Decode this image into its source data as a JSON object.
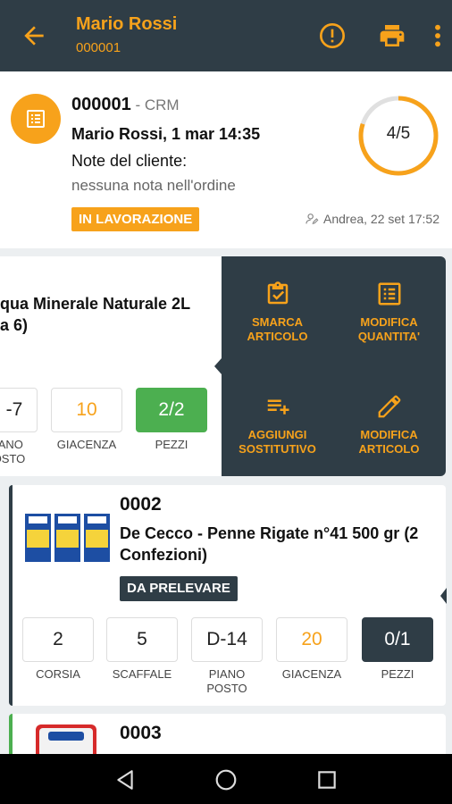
{
  "appbar": {
    "title": "Mario Rossi",
    "subtitle": "000001",
    "icons": [
      "back-arrow-icon",
      "alert-circle-icon",
      "printer-icon",
      "more-vert-icon"
    ]
  },
  "order": {
    "number": "000001",
    "source": " - CRM",
    "customer_line": "Mario Rossi, 1 mar 14:35",
    "note_label": "Note del cliente:",
    "note_value": "nessuna nota nell'ordine",
    "status": "IN LAVORAZIONE",
    "assignee": "Andrea, 22 set 17:52",
    "progress_text": "4/5",
    "progress_fraction": 0.8
  },
  "item1": {
    "name_line1": "qua Minerale Naturale 2L",
    "name_line2": "a 6)",
    "position_value": "-7",
    "position_label_1": "IANO",
    "position_label_2": "OSTO",
    "stock_value": "10",
    "stock_label": "GIACENZA",
    "pieces_value": "2/2",
    "pieces_label": "PEZZI"
  },
  "actions": [
    {
      "line1": "SMARCA",
      "line2": "ARTICOLO",
      "icon": "clipboard-check-icon"
    },
    {
      "line1": "MODIFICA",
      "line2": "QUANTITA'",
      "icon": "list-box-icon"
    },
    {
      "line1": "AGGIUNGI",
      "line2": "SOSTITUTIVO",
      "icon": "playlist-add-icon"
    },
    {
      "line1": "MODIFICA",
      "line2": "ARTICOLO",
      "icon": "pencil-icon"
    }
  ],
  "item2": {
    "code": "0002",
    "name": "De Cecco - Penne Rigate n°41 500 gr (2 Confezioni)",
    "status": "DA PRELEVARE",
    "fields": [
      {
        "value": "2",
        "label_1": "CORSIA",
        "label_2": ""
      },
      {
        "value": "5",
        "label_1": "SCAFFALE",
        "label_2": ""
      },
      {
        "value": "D-14",
        "label_1": "PIANO",
        "label_2": "POSTO"
      },
      {
        "value": "20",
        "label_1": "GIACENZA",
        "label_2": ""
      },
      {
        "value": "0/1",
        "label_1": "PEZZI",
        "label_2": ""
      }
    ]
  },
  "item3": {
    "code": "0003"
  },
  "colors": {
    "accent": "#f7a21b",
    "dark": "#2f3d46",
    "success": "#4caf50"
  }
}
